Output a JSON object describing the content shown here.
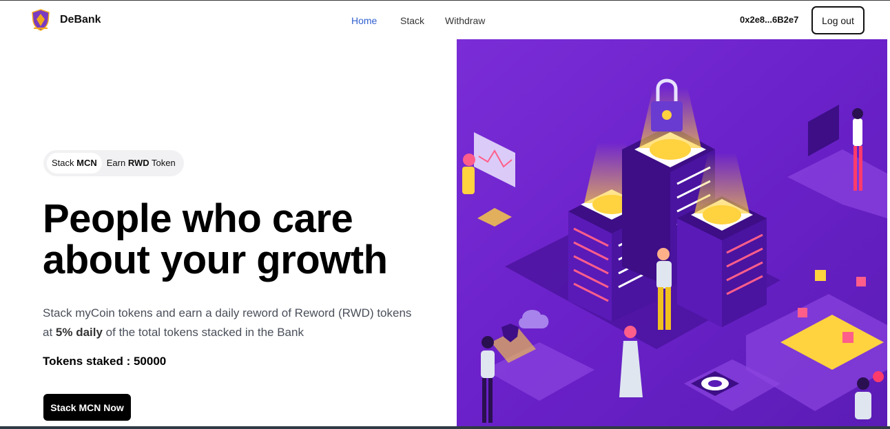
{
  "header": {
    "brand": "DeBank",
    "nav": [
      {
        "label": "Home",
        "active": true
      },
      {
        "label": "Stack",
        "active": false
      },
      {
        "label": "Withdraw",
        "active": false
      }
    ],
    "wallet_address": "0x2e8...6B2e7",
    "logout_label": "Log out"
  },
  "hero": {
    "pill": {
      "stack_prefix": "Stack ",
      "stack_token": "MCN",
      "earn_prefix": "Earn ",
      "earn_token": "RWD",
      "earn_suffix": " Token"
    },
    "headline": "People who care about your growth",
    "description_part1": "Stack myCoin tokens and earn a daily reword of Reword (RWD) tokens at ",
    "description_bold": "5% daily",
    "description_part2": " of the total tokens stacked in the Bank",
    "tokens_staked_label": "Tokens staked : ",
    "tokens_staked_value": "50000",
    "cta_label": "Stack MCN Now"
  },
  "colors": {
    "accent_nav": "#2f5fd0",
    "illustration_bg": "#6a21c9",
    "coin": "#ffd23f"
  }
}
